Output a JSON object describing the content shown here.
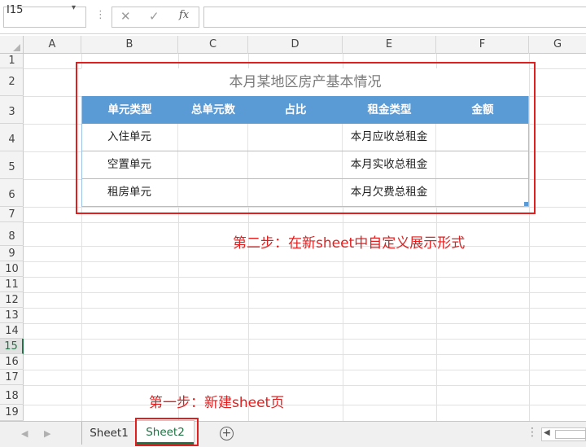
{
  "formula_bar": {
    "name_box": "I15",
    "fx_label": "fx",
    "formula": ""
  },
  "columns": [
    "A",
    "B",
    "C",
    "D",
    "E",
    "F",
    "G"
  ],
  "rows": [
    "1",
    "2",
    "3",
    "4",
    "5",
    "6",
    "7",
    "8",
    "9",
    "10",
    "11",
    "12",
    "13",
    "14",
    "15",
    "16",
    "17",
    "18",
    "19"
  ],
  "active_row": "15",
  "table": {
    "title": "本月某地区房产基本情况",
    "headers": [
      "单元类型",
      "总单元数",
      "占比",
      "租金类型",
      "金额"
    ],
    "rows": [
      [
        "入住单元",
        "",
        "",
        "本月应收总租金",
        ""
      ],
      [
        "空置单元",
        "",
        "",
        "本月实收总租金",
        ""
      ],
      [
        "租房单元",
        "",
        "",
        "本月欠费总租金",
        ""
      ]
    ]
  },
  "annotations": {
    "step2": "第二步：在新sheet中自定义展示形式",
    "step1": "第一步：新建sheet页"
  },
  "tabs": [
    {
      "label": "Sheet1",
      "active": false
    },
    {
      "label": "Sheet2",
      "active": true
    }
  ],
  "colors": {
    "table_header": "#5b9bd5",
    "annotation": "#e02020",
    "active_tab": "#217346"
  }
}
